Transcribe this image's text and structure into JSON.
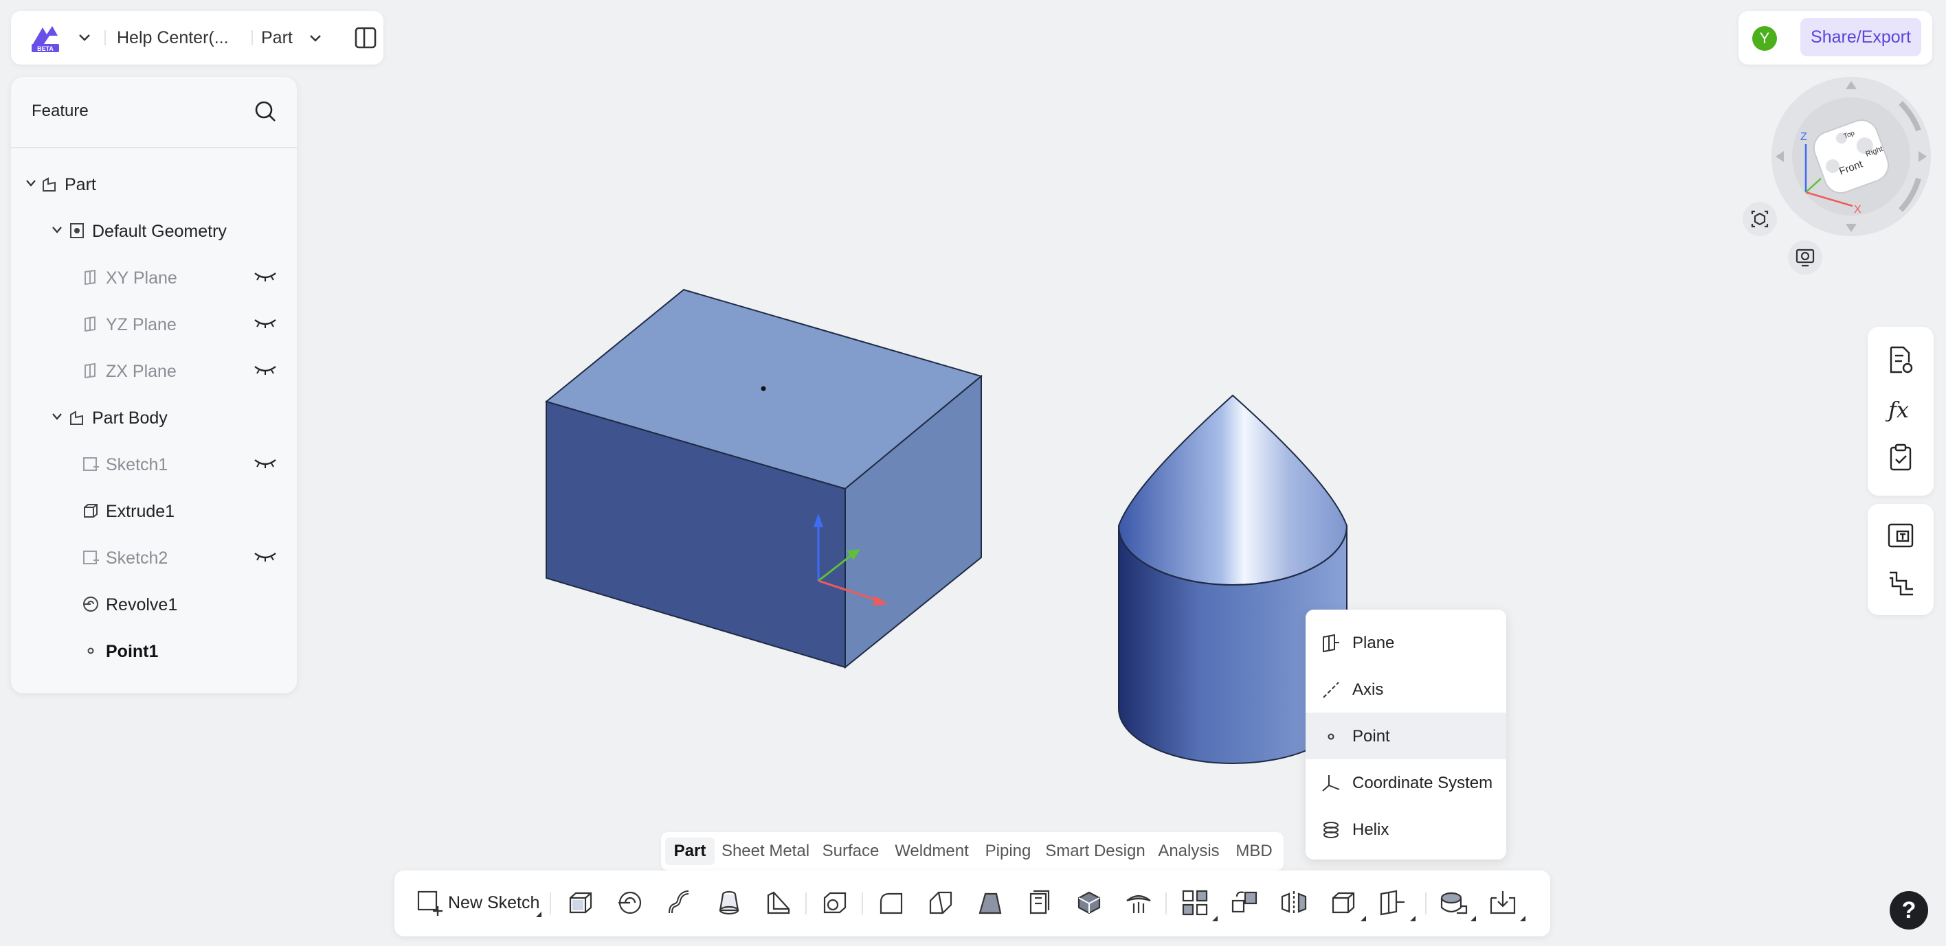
{
  "topbar": {
    "logo_badge": "BETA",
    "document_title": "Help Center(...",
    "mode": "Part"
  },
  "topright": {
    "avatar_initial": "Y",
    "share_label": "Share/Export"
  },
  "feature_panel": {
    "title": "Feature",
    "tree": [
      {
        "label": "Part",
        "icon": "part-icon",
        "expanded": true,
        "visible_toggle": false
      },
      {
        "label": "Default Geometry",
        "icon": "default-geometry-icon",
        "expanded": true,
        "visible_toggle": false
      },
      {
        "label": "XY Plane",
        "icon": "plane-icon",
        "hidden": true
      },
      {
        "label": "YZ Plane",
        "icon": "plane-icon",
        "hidden": true
      },
      {
        "label": "ZX Plane",
        "icon": "plane-icon",
        "hidden": true
      },
      {
        "label": "Part Body",
        "icon": "part-body-icon",
        "expanded": true
      },
      {
        "label": "Sketch1",
        "icon": "sketch-icon",
        "hidden": true
      },
      {
        "label": "Extrude1",
        "icon": "extrude-icon",
        "hidden": false
      },
      {
        "label": "Sketch2",
        "icon": "sketch-icon",
        "hidden": true
      },
      {
        "label": "Revolve1",
        "icon": "revolve-icon",
        "hidden": false
      },
      {
        "label": "Point1",
        "icon": "point-icon",
        "hidden": false,
        "selected": true
      }
    ]
  },
  "viewcube": {
    "axis_z": "Z",
    "axis_x": "X",
    "face_front": "Front",
    "face_right": "Right",
    "face_top": "Top"
  },
  "context_menu": {
    "items": [
      {
        "label": "Plane",
        "icon": "plane-icon"
      },
      {
        "label": "Axis",
        "icon": "axis-icon"
      },
      {
        "label": "Point",
        "icon": "point-icon",
        "active": true
      },
      {
        "label": "Coordinate System",
        "icon": "coordinate-system-icon"
      },
      {
        "label": "Helix",
        "icon": "helix-icon"
      }
    ]
  },
  "tabs": [
    {
      "label": "Part",
      "active": true
    },
    {
      "label": "Sheet Metal"
    },
    {
      "label": "Surface"
    },
    {
      "label": "Weldment"
    },
    {
      "label": "Piping"
    },
    {
      "label": "Smart Design"
    },
    {
      "label": "Analysis"
    },
    {
      "label": "MBD"
    }
  ],
  "toolbar": {
    "new_sketch_label": "New Sketch"
  },
  "help_label": "?",
  "colors": {
    "accent": "#5a46d8",
    "share_bg": "#e7e4fb",
    "avatar": "#4caf1c",
    "box_top": "#829ccc",
    "box_front": "#3f548f",
    "box_side": "#6c86b8",
    "cone_light": "#f2f7ff",
    "cylinder": "#5a72b4"
  }
}
